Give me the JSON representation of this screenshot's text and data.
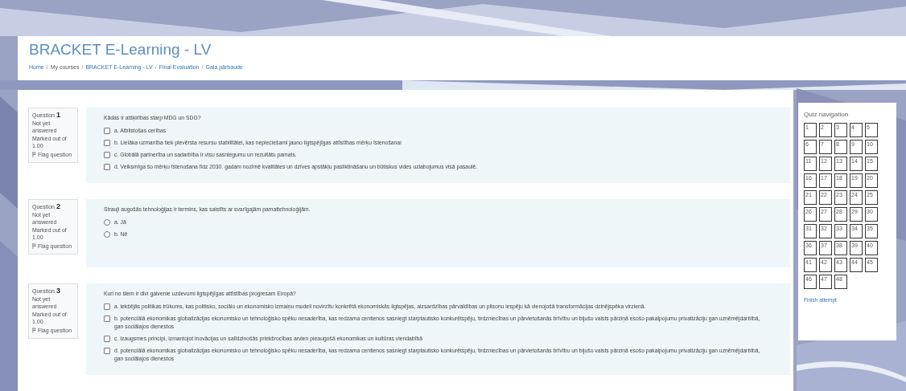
{
  "page_title": "BRACKET E-Learning - LV",
  "breadcrumb": [
    "Home",
    "My courses",
    "BRACKET E-Learning - LV",
    "Final Evaluation",
    "Gala pārbaude"
  ],
  "breadcrumb_separator": "/",
  "questions": [
    {
      "label": "Question",
      "number": "1",
      "status": "Not yet answered",
      "marks": "Marked out of 1.00",
      "flag": "Flag question",
      "text": "Kādas ir atšķirības starp MDG un SDG?",
      "kind": "checkbox",
      "options": [
        {
          "text": "a. Atbilstošas cerības",
          "checked": false
        },
        {
          "text": "b. Lielāka uzmanība tiek pievērsta resursu stabilitātei, kas nepieciešami jauno ilgtspējīgas attīstības mērķu īstenošanai",
          "checked": false
        },
        {
          "text": "c. Globālā partnerība un sadarbība ir visu sasniegumu un rezultātu pamats.",
          "checked": false
        },
        {
          "text": "d. Veiksmīga šo mērķu īstenošana līdz 2030. gadam nozīmē kvalitātes un dzīves apstākļu pasliktināšanu un būtiskus vides uzlabojumus visā pasaulē.",
          "checked": false
        }
      ]
    },
    {
      "label": "Question",
      "number": "2",
      "status": "Not yet answered",
      "marks": "Marked out of 1.00",
      "flag": "Flag question",
      "text": "Strauji augošās tehnoloģijas ir termins, kas saistīts ar svarīgajām pamattehnoloģijām.",
      "kind": "radio",
      "options": [
        {
          "text": "a. Jā",
          "checked": false
        },
        {
          "text": "b. Nē",
          "checked": false
        }
      ]
    },
    {
      "label": "Question",
      "number": "3",
      "status": "Not yet answered",
      "marks": "Marked out of 1.00",
      "flag": "Flag question",
      "text": "Kuri no šiem ir divi galvenie uzdevumi ilgtspējīgas attīstības progresam Eiropā?",
      "kind": "checkbox",
      "options": [
        {
          "text": "a. iekšējās politikas trūkums, kas politisko, sociālo un ekonomisko izmaiņu modeli novirzītu konkrētā ekonomiskās ilgtspējas, aizsardzības pārvaldības un pilsoņu iespēju kā vienojošā transformācijas dzinējspēka virzienā.",
          "checked": false
        },
        {
          "text": "b. potenciālā ekonomikas globalizācijas ekonomisko un tehnoloģisko spēku nesaderība, kas redzama centienos sasniegt starptautisko konkurētspēju, tirdzniecības un pārvietošanās brīvību un bijušo valsts pārziņā esošo pakalpojumu privatizāciju gan uzņēmējdarbībā, gan sociālajos dienestos",
          "checked": false
        },
        {
          "text": "c. Izaugsmes principi, izmantojot inovācijas un salīdzinošās priekšrocības arvien pieaugošā ekonomikas un kultūras viendabībā",
          "checked": false
        },
        {
          "text": "d. potenciālā ekonomikas globalizācijas ekonomisko un tehnoloģisko spēku nesaderība, kas redzama centienos sasniegt starptautisko konkurētspēju, tirdzniecības un pārvietošanās brīvību un bijušo valsts pārziņā esošo pakalpojumu privatizāciju gan uzņēmējdarbībā, gan sociālajos dienestos",
          "checked": false
        }
      ]
    }
  ],
  "quiz_navigation": {
    "title": "Quiz navigation",
    "buttons": [
      "1",
      "2",
      "3",
      "4",
      "5",
      "6",
      "7",
      "8",
      "9",
      "10",
      "11",
      "12",
      "13",
      "14",
      "15",
      "16",
      "17",
      "18",
      "19",
      "20",
      "21",
      "22",
      "23",
      "24",
      "25",
      "26",
      "27",
      "28",
      "29",
      "30",
      "31",
      "32",
      "33",
      "34",
      "35",
      "36",
      "37",
      "38",
      "39",
      "40",
      "41",
      "42",
      "43",
      "44",
      "45",
      "46",
      "47",
      "48"
    ],
    "finish": "Finish attempt"
  }
}
